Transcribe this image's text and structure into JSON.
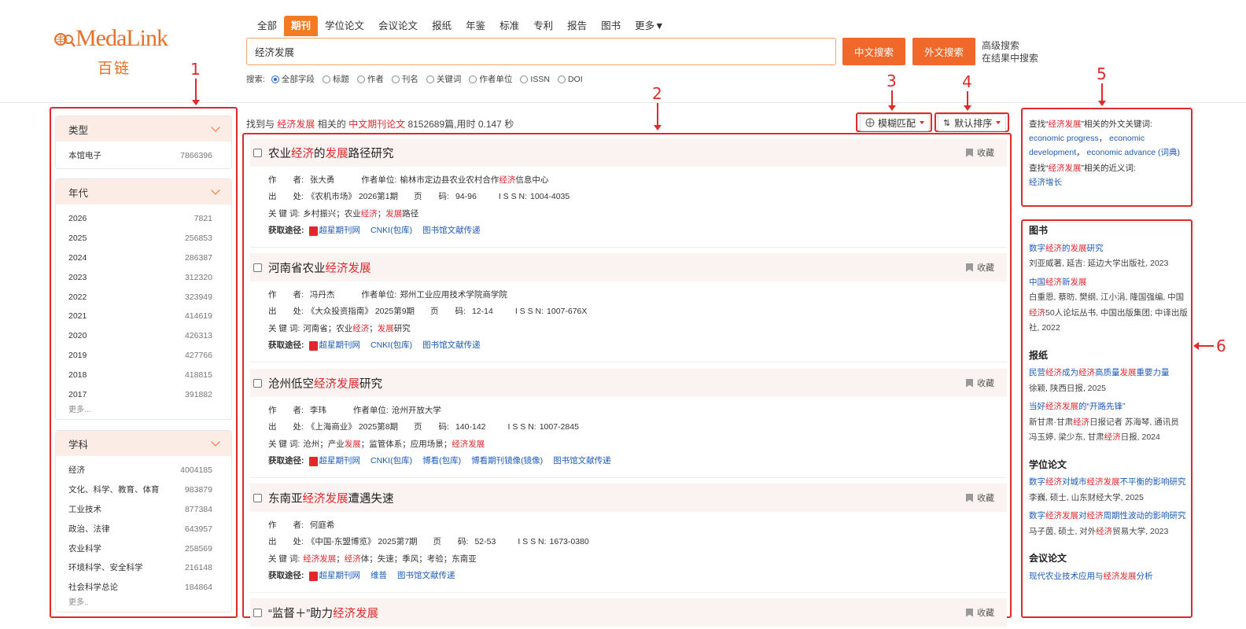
{
  "logo": {
    "brand": "MedaLink",
    "subtitle": "百链"
  },
  "tabs": [
    "全部",
    "期刊",
    "学位论文",
    "会议论文",
    "报纸",
    "年鉴",
    "标准",
    "专利",
    "报告",
    "图书",
    "更多▼"
  ],
  "active_tab": "期刊",
  "search": {
    "query": "经济发展",
    "cn_button": "中文搜索",
    "foreign_button": "外文搜索",
    "advanced": "高级搜索",
    "within": "在结果中搜索",
    "fields_label": "搜索:",
    "fields": [
      "全部字段",
      "标题",
      "作者",
      "刊名",
      "关键词",
      "作者单位",
      "ISSN",
      "DOI"
    ],
    "selected_field": "全部字段"
  },
  "annotations": [
    "1",
    "2",
    "3",
    "4",
    "5",
    "6"
  ],
  "facets": [
    {
      "title": "类型",
      "items": [
        {
          "label": "本馆电子",
          "count": "7866396"
        }
      ],
      "more": ""
    },
    {
      "title": "年代",
      "items": [
        {
          "label": "2026",
          "count": "7821"
        },
        {
          "label": "2025",
          "count": "256853"
        },
        {
          "label": "2024",
          "count": "286387"
        },
        {
          "label": "2023",
          "count": "312320"
        },
        {
          "label": "2022",
          "count": "323949"
        },
        {
          "label": "2021",
          "count": "414619"
        },
        {
          "label": "2020",
          "count": "426313"
        },
        {
          "label": "2019",
          "count": "427766"
        },
        {
          "label": "2018",
          "count": "418815"
        },
        {
          "label": "2017",
          "count": "391882"
        }
      ],
      "more": "更多..."
    },
    {
      "title": "学科",
      "items": [
        {
          "label": "经济",
          "count": "4004185"
        },
        {
          "label": "文化、科学、教育、体育",
          "count": "983879"
        },
        {
          "label": "工业技术",
          "count": "877384"
        },
        {
          "label": "政治、法律",
          "count": "643957"
        },
        {
          "label": "农业科学",
          "count": "258569"
        },
        {
          "label": "环境科学、安全科学",
          "count": "216148"
        },
        {
          "label": "社会科学总论",
          "count": "184864"
        }
      ],
      "more": "更多.."
    }
  ],
  "summary": {
    "pre": "找到与",
    "kw": "经济发展",
    "mid": "相关的",
    "type": "中文期刊论文",
    "count": "8152689",
    "post": "篇,用时 0.147 秒"
  },
  "match_button": "模糊匹配",
  "sort_button": "默认排序",
  "labels": {
    "author": "作　　者:",
    "unit": "作者单位:",
    "source": "出　　处:",
    "pages": "页　　码:",
    "issn": "I S S N:",
    "keywords": "关 键 词:",
    "access": "获取途径:",
    "favorite": "收藏"
  },
  "results": [
    {
      "title": [
        [
          "农业",
          false
        ],
        [
          "经济",
          true
        ],
        [
          "的",
          false
        ],
        [
          "发展",
          true
        ],
        [
          "路径研究",
          false
        ]
      ],
      "author": "张大勇",
      "unit": [
        [
          "榆林市定边县农业农村合作",
          false
        ],
        [
          "经济",
          true
        ],
        [
          "信息中心",
          false
        ]
      ],
      "source": "《农机市场》 2026第1期",
      "pages": "94-96",
      "issn": "1004-4035",
      "keywords": [
        [
          "乡村振兴；农业",
          false
        ],
        [
          "经济",
          true
        ],
        [
          "；",
          false
        ],
        [
          "发展",
          true
        ],
        [
          "路径",
          false
        ]
      ],
      "links": [
        "超星期刊网",
        "CNKI(包库)",
        "图书馆文献传递"
      ]
    },
    {
      "title": [
        [
          "河南省农业",
          false
        ],
        [
          "经济发展",
          true
        ]
      ],
      "author": "冯丹杰",
      "unit": [
        [
          "郑州工业应用技术学院商学院",
          false
        ]
      ],
      "source": "《大众投资指南》 2025第9期",
      "pages": "12-14",
      "issn": "1007-676X",
      "keywords": [
        [
          "河南省；农业",
          false
        ],
        [
          "经济",
          true
        ],
        [
          "；",
          false
        ],
        [
          "发展",
          true
        ],
        [
          "研究",
          false
        ]
      ],
      "links": [
        "超星期刊网",
        "CNKI(包库)",
        "图书馆文献传递"
      ]
    },
    {
      "title": [
        [
          "沧州低空",
          false
        ],
        [
          "经济发展",
          true
        ],
        [
          "研究",
          false
        ]
      ],
      "author": "李玮",
      "unit": [
        [
          "沧州开放大学",
          false
        ]
      ],
      "source": "《上海商业》 2025第8期",
      "pages": "140-142",
      "issn": "1007-2845",
      "keywords": [
        [
          "沧州；产业",
          false
        ],
        [
          "发展",
          true
        ],
        [
          "；监管体系；应用场景；",
          false
        ],
        [
          "经济发展",
          true
        ]
      ],
      "links": [
        "超星期刊网",
        "CNKI(包库)",
        "博看(包库)",
        "博看期刊镜像(镜像)",
        "图书馆文献传递"
      ]
    },
    {
      "title": [
        [
          "东南亚",
          false
        ],
        [
          "经济发展",
          true
        ],
        [
          "遭遇失速",
          false
        ]
      ],
      "author": "何庭希",
      "unit": null,
      "source": "《中国-东盟博览》 2025第7期",
      "pages": "52-53",
      "issn": "1673-0380",
      "keywords": [
        [
          "经济发展",
          true
        ],
        [
          "；",
          false
        ],
        [
          "经济",
          true
        ],
        [
          "体；失速；季风；考验；东南亚",
          false
        ]
      ],
      "links": [
        "超星期刊网",
        "维普",
        "图书馆文献传递"
      ]
    },
    {
      "title": [
        [
          "“监督＋”助力",
          false
        ],
        [
          "经济发展",
          true
        ]
      ],
      "author": "",
      "unit": null,
      "source": "",
      "pages": "",
      "issn": "",
      "keywords": [],
      "links": []
    }
  ],
  "related": {
    "foreign_pre": "查找“",
    "kw": "经济发展",
    "foreign_post": "”相关的外文关键词:",
    "foreign_terms": [
      "economic progress",
      "economic development",
      "economic advance (词典)"
    ],
    "syn_pre": "查找“",
    "syn_post": "”相关的近义词:",
    "synonyms": [
      "经济增长"
    ]
  },
  "recommendations": [
    {
      "section": "图书",
      "items": [
        {
          "title": [
            [
              "数字",
              false
            ],
            [
              "经济",
              true
            ],
            [
              "的",
              false
            ],
            [
              "发展",
              true
            ],
            [
              "研究",
              false
            ]
          ],
          "by": [
            [
              "刘亚威著, 延吉: 延边大学出版社, 2023",
              false
            ]
          ]
        },
        {
          "title": [
            [
              "中国",
              false
            ],
            [
              "经济",
              true
            ],
            [
              "新",
              false
            ],
            [
              "发展",
              true
            ]
          ],
          "by": [
            [
              "白重恩, 蔡昉, 樊纲, 江小涓, 隆国强编, 中国",
              false
            ],
            [
              "经济",
              true
            ],
            [
              "50人论坛丛书, 中国出版集团; 中译出版社, 2022",
              false
            ]
          ]
        }
      ]
    },
    {
      "section": "报纸",
      "items": [
        {
          "title": [
            [
              "民营",
              false
            ],
            [
              "经济",
              true
            ],
            [
              "成为",
              false
            ],
            [
              "经济",
              true
            ],
            [
              "高质量",
              false
            ],
            [
              "发展",
              true
            ],
            [
              "重要力量",
              false
            ]
          ],
          "by": [
            [
              "徐颖, 陕西日报, 2025",
              false
            ]
          ]
        },
        {
          "title": [
            [
              "当好",
              false
            ],
            [
              "经济发展",
              true
            ],
            [
              "的“开路先锋”",
              false
            ]
          ],
          "by": [
            [
              "新甘肃·甘肃",
              false
            ],
            [
              "经济",
              true
            ],
            [
              "日报记者 苏海琴, 通讯员 冯玉婷, 梁少东, 甘肃",
              false
            ],
            [
              "经济",
              true
            ],
            [
              "日报, 2024",
              false
            ]
          ]
        }
      ]
    },
    {
      "section": "学位论文",
      "items": [
        {
          "title": [
            [
              "数字",
              false
            ],
            [
              "经济",
              true
            ],
            [
              "对城市",
              false
            ],
            [
              "经济发展",
              true
            ],
            [
              "不平衡的影响研究",
              false
            ]
          ],
          "by": [
            [
              "李巍, 硕士, 山东财经大学, 2025",
              false
            ]
          ]
        },
        {
          "title": [
            [
              "数字",
              false
            ],
            [
              "经济发展",
              true
            ],
            [
              "对",
              false
            ],
            [
              "经济",
              true
            ],
            [
              "周期性波动的影响研究",
              false
            ]
          ],
          "by": [
            [
              "马子茵, 硕士, 对外",
              false
            ],
            [
              "经济",
              true
            ],
            [
              "贸易大学, 2023",
              false
            ]
          ]
        }
      ]
    },
    {
      "section": "会议论文",
      "items": [
        {
          "title": [
            [
              "现代农业技术应用与",
              false
            ],
            [
              "经济发展",
              true
            ],
            [
              "分析",
              false
            ]
          ],
          "by": []
        }
      ]
    }
  ]
}
